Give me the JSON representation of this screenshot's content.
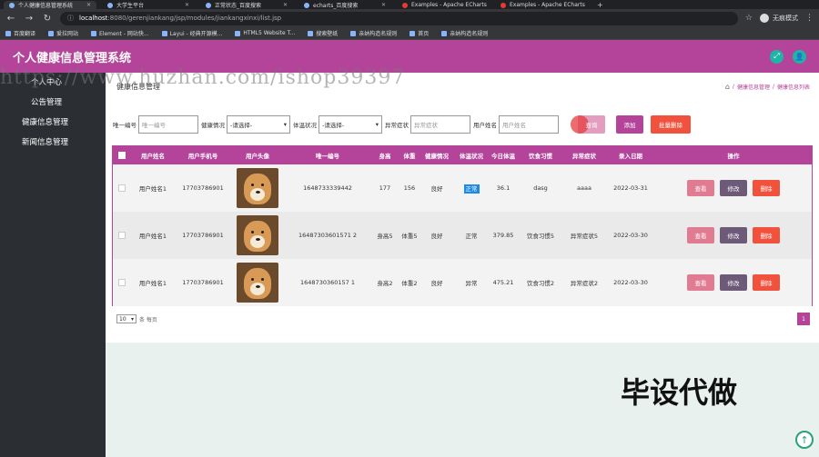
{
  "browser": {
    "tabs": [
      {
        "label": "个人健康信息管理系统",
        "active": true
      },
      {
        "label": "大学生平台",
        "active": false
      },
      {
        "label": "正常状态_百度搜索",
        "active": false
      },
      {
        "label": "echarts_百度搜索",
        "active": false
      },
      {
        "label": "Examples - Apache ECharts",
        "active": false
      },
      {
        "label": "Examples - Apache ECharts",
        "active": false
      }
    ],
    "new_tab": "+",
    "url_host": "localhost",
    "url_rest": ":8080/gerenjiankang/jsp/modules/jiankangxinxi/list.jsp",
    "profile_label": "无痕模式",
    "bookmarks": [
      "百度翻译",
      "爱拉网站",
      "Element - 网站快...",
      "Layui - 经典开源模...",
      "HTML5 Website T...",
      "搜索壁纸",
      "亲纳构造名规则",
      "首页",
      "亲纳构造名规则"
    ]
  },
  "app": {
    "title": "个人健康信息管理系统",
    "sidebar": [
      {
        "label": "个人中心",
        "sub": true
      },
      {
        "label": "公告管理",
        "sub": true
      },
      {
        "label": "健康信息管理",
        "sub": false
      },
      {
        "label": "新闻信息管理",
        "sub": false
      }
    ],
    "page_heading": "健康信息管理",
    "breadcrumb": [
      "健康信息管理",
      "健康信息列表"
    ],
    "search": {
      "code_label": "唯一编号",
      "code_placeholder": "唯一编号",
      "health_label": "健康情况",
      "health_value": "-请选择-",
      "body_label": "体温状况",
      "body_value": "-请选择-",
      "abnormal_label": "异常症状",
      "abnormal_placeholder": "异常症状",
      "name_label": "用户姓名",
      "name_placeholder": "用户姓名",
      "search_btn": "查询",
      "add_btn": "添加",
      "bulk_delete_btn": "批量删除"
    },
    "table": {
      "headers": [
        "用户姓名",
        "用户手机号",
        "用户头像",
        "唯一编号",
        "身高",
        "体重",
        "健康情况",
        "体温状况",
        "今日体温",
        "饮食习惯",
        "异常症状",
        "录入日期",
        "操作"
      ],
      "rows": [
        {
          "name": "用户姓名1",
          "phone": "17703786901",
          "code": "1648733339442",
          "height": "177",
          "weight": "156",
          "health": "良好",
          "body_status": "正常",
          "today_temp": "36.1",
          "diet": "dasg",
          "abnormal": "aaaa",
          "date": "2022-03-31"
        },
        {
          "name": "用户姓名1",
          "phone": "17703786901",
          "code": "16487303601571 2",
          "height": "身高5",
          "weight": "体重5",
          "health": "良好",
          "body_status": "正常",
          "today_temp": "379.85",
          "diet": "饮食习惯5",
          "abnormal": "异常症状5",
          "date": "2022-03-30"
        },
        {
          "name": "用户姓名1",
          "phone": "17703786901",
          "code": "1648730360157 1",
          "height": "身高2",
          "weight": "体重2",
          "health": "良好",
          "body_status": "异常",
          "today_temp": "475.21",
          "diet": "饮食习惯2",
          "abnormal": "异常症状2",
          "date": "2022-03-30"
        }
      ],
      "ops": {
        "view": "查看",
        "edit": "修改",
        "delete": "删除"
      }
    },
    "pager": {
      "page_size": "10",
      "page_size_label": "条 每页",
      "current_page": "1"
    }
  },
  "overlays": {
    "watermark_url": "https://www.huzhan.com/ishop39397",
    "watermark_cn": "毕设代做",
    "scroll_top_icon": "↑"
  },
  "colors": {
    "brand": "#b4449a",
    "sidebar": "#2b2e33",
    "teal": "#1fb5a5",
    "danger": "#f0523d"
  }
}
